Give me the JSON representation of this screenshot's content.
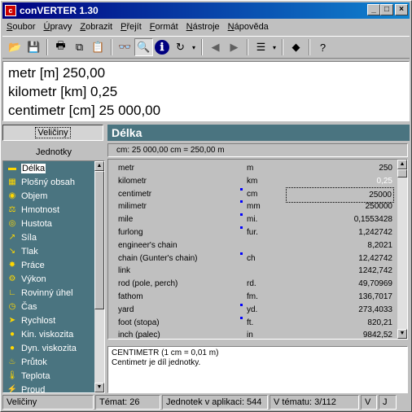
{
  "title": "conVERTER 1.30",
  "window_buttons": {
    "minimize": "_",
    "maximize": "□",
    "close": "×"
  },
  "menu": [
    "Soubor",
    "Úpravy",
    "Zobrazit",
    "Přejít",
    "Formát",
    "Nástroje",
    "Nápověda"
  ],
  "toolbar": {
    "icons": [
      "open-icon",
      "save-icon",
      "print-icon",
      "copy-icon",
      "paste-icon",
      "glasses-icon",
      "find-icon",
      "info-icon",
      "rotate-icon",
      "dropdown-arrow-icon",
      "back-arrow-icon",
      "forward-arrow-icon",
      "list-icon",
      "dropdown-arrow-icon",
      "bullet-icon",
      "help-icon"
    ],
    "glyphs": [
      "📂",
      "💾",
      "🖶",
      "⧉",
      "📋",
      "👓",
      "🔍",
      "ℹ",
      "↻",
      "▾",
      "◀",
      "▶",
      "☰",
      "▾",
      "◆",
      "?"
    ]
  },
  "result_lines": [
    "metr [m] 250,00",
    "kilometr [km] 0,25",
    "centimetr [cm] 25 000,00"
  ],
  "left": {
    "tab_label": "Veličiny",
    "units_label": "Jednotky",
    "categories": [
      {
        "label": "Délka",
        "icon": "ruler-icon",
        "glyph": "▬"
      },
      {
        "label": "Plošný obsah",
        "icon": "area-icon",
        "glyph": "▦"
      },
      {
        "label": "Objem",
        "icon": "volume-icon",
        "glyph": "◉"
      },
      {
        "label": "Hmotnost",
        "icon": "scale-icon",
        "glyph": "⚖"
      },
      {
        "label": "Hustota",
        "icon": "density-icon",
        "glyph": "◎"
      },
      {
        "label": "Síla",
        "icon": "force-icon",
        "glyph": "↗"
      },
      {
        "label": "Tlak",
        "icon": "pressure-icon",
        "glyph": "↘"
      },
      {
        "label": "Práce",
        "icon": "work-icon",
        "glyph": "✸"
      },
      {
        "label": "Výkon",
        "icon": "power-icon",
        "glyph": "⚙"
      },
      {
        "label": "Rovinný úhel",
        "icon": "angle-icon",
        "glyph": "∟"
      },
      {
        "label": "Čas",
        "icon": "clock-icon",
        "glyph": "◷"
      },
      {
        "label": "Rychlost",
        "icon": "speed-icon",
        "glyph": "➤"
      },
      {
        "label": "Kin. viskozita",
        "icon": "kin-viscosity-icon",
        "glyph": "●"
      },
      {
        "label": "Dyn. viskozita",
        "icon": "dyn-viscosity-icon",
        "glyph": "●"
      },
      {
        "label": "Průtok",
        "icon": "flow-icon",
        "glyph": "♨"
      },
      {
        "label": "Teplota",
        "icon": "thermometer-icon",
        "glyph": "🌡"
      },
      {
        "label": "Proud",
        "icon": "current-icon",
        "glyph": "⚡"
      }
    ]
  },
  "right": {
    "category_title": "Délka",
    "info": "cm: 25 000,00 cm = 250,00 m",
    "units": [
      {
        "name": "metr",
        "abbr": "m",
        "value": "250",
        "dot": false
      },
      {
        "name": "kilometr",
        "abbr": "km",
        "value": "0,25",
        "dot": false,
        "selected": true
      },
      {
        "name": "centimetr",
        "abbr": "cm",
        "value": "25000",
        "dot": true,
        "current": true
      },
      {
        "name": "milimetr",
        "abbr": "mm",
        "value": "250000",
        "dot": true
      },
      {
        "name": "mile",
        "abbr": "mi.",
        "value": "0,1553428",
        "dot": true
      },
      {
        "name": "furlong",
        "abbr": "fur.",
        "value": "1,242742",
        "dot": true
      },
      {
        "name": "engineer's chain",
        "abbr": "",
        "value": "8,2021",
        "dot": false
      },
      {
        "name": "chain (Gunter's chain)",
        "abbr": "ch",
        "value": "12,42742",
        "dot": true
      },
      {
        "name": "link",
        "abbr": "",
        "value": "1242,742",
        "dot": false
      },
      {
        "name": "rod (pole, perch)",
        "abbr": "rd.",
        "value": "49,70969",
        "dot": false
      },
      {
        "name": "fathom",
        "abbr": "fm.",
        "value": "136,7017",
        "dot": false
      },
      {
        "name": "yard",
        "abbr": "yd.",
        "value": "273,4033",
        "dot": true
      },
      {
        "name": "foot (stopa)",
        "abbr": "ft.",
        "value": "820,21",
        "dot": true
      },
      {
        "name": "inch (palec)",
        "abbr": "in",
        "value": "9842,52",
        "dot": false
      }
    ],
    "desc_title": "CENTIMETR (1 cm = 0,01 m)",
    "desc_text": "Centimetr je díl jednotky."
  },
  "status": {
    "section": "Veličiny",
    "topics": "Témat: 26",
    "units_count": "Jednotek v aplikaci: 544",
    "in_topic": "V tématu: 3/112",
    "v": "V",
    "j": "J"
  }
}
